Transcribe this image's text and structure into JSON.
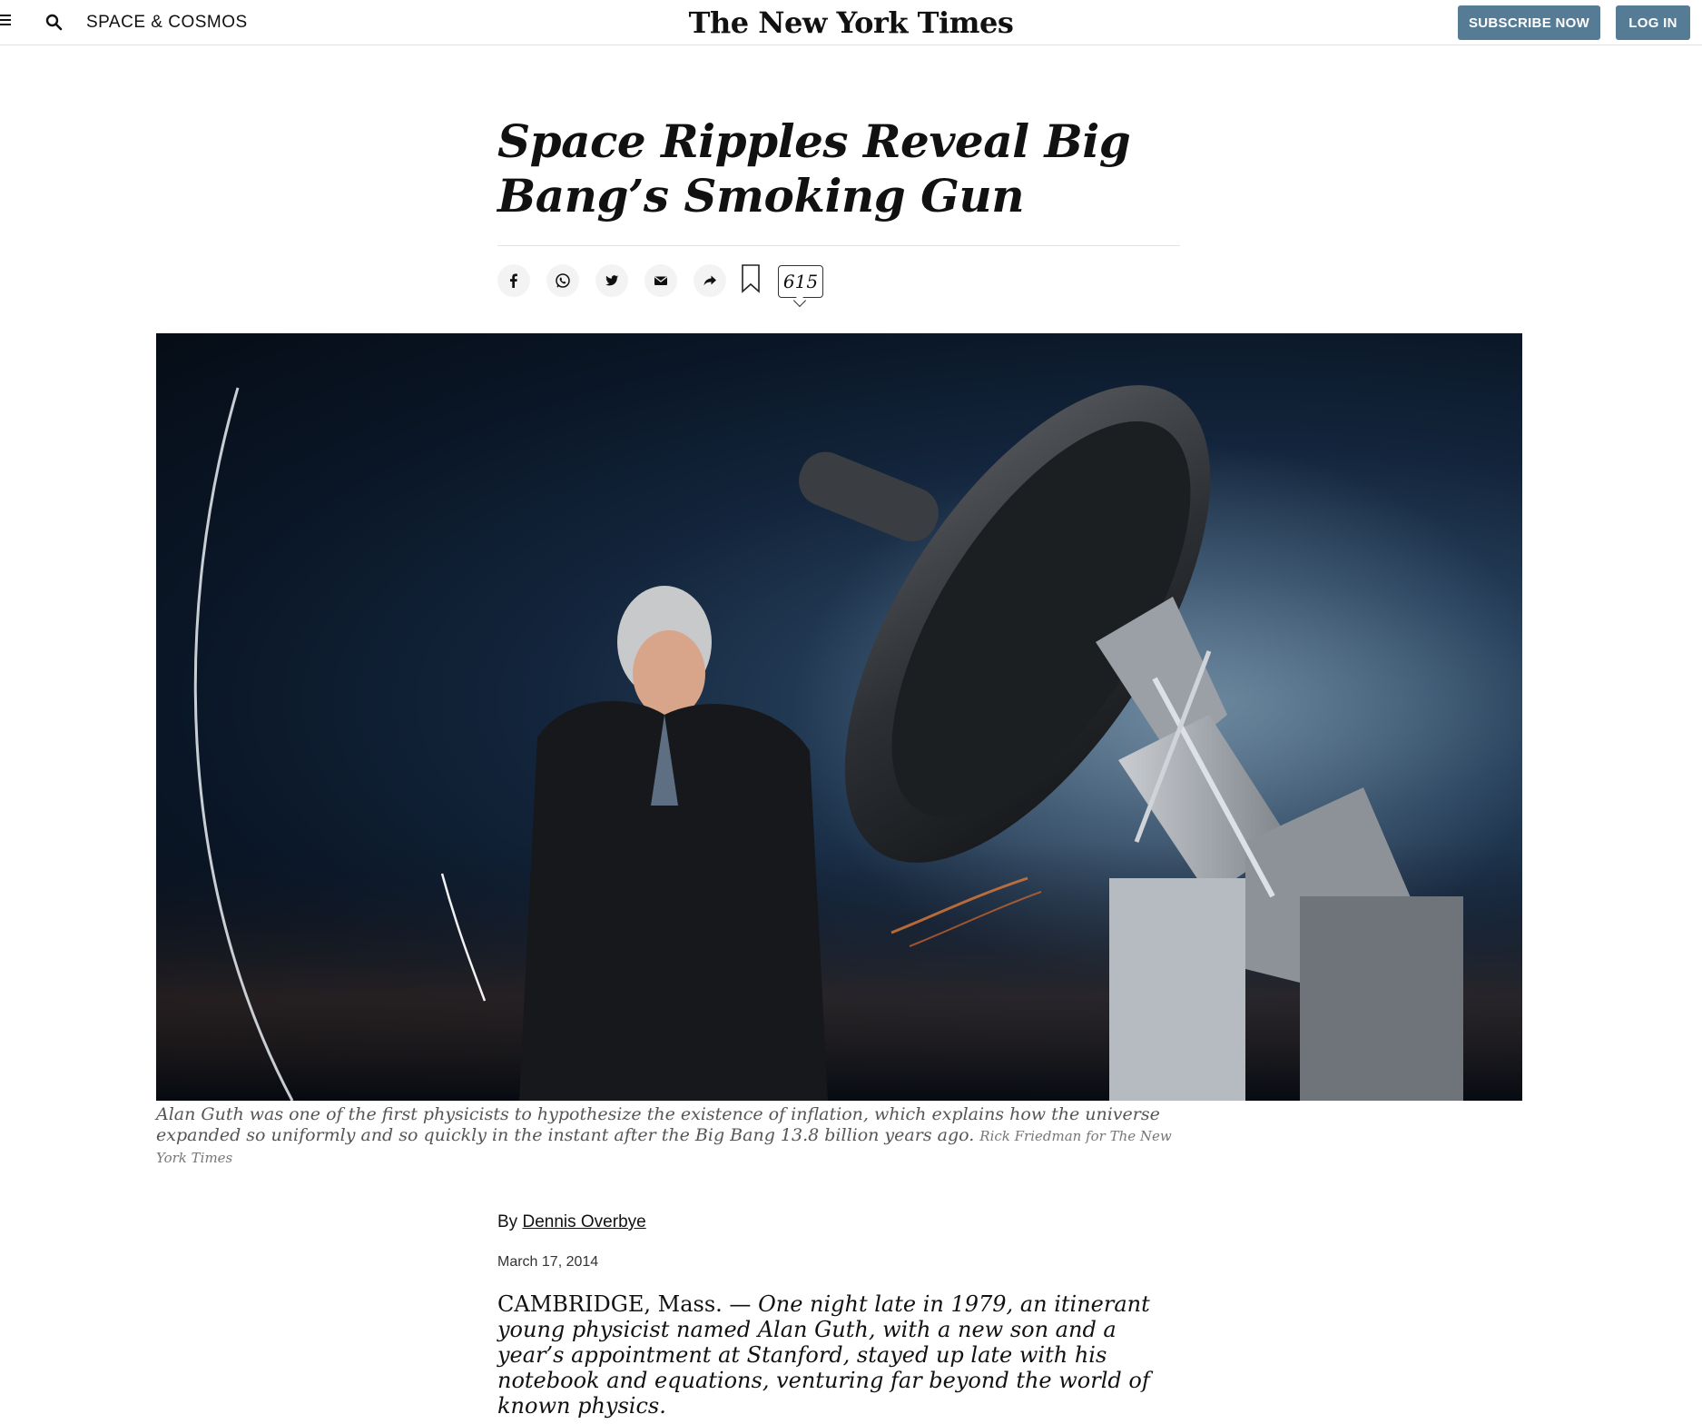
{
  "header": {
    "section": "SPACE & COSMOS",
    "masthead": "The New York Times",
    "subscribe_label": "SUBSCRIBE NOW",
    "login_label": "LOG IN"
  },
  "article": {
    "headline": "Space Ripples Reveal Big Bang’s Smoking Gun",
    "comment_count": "615",
    "caption": "Alan Guth was one of the first physicists to hypothesize the existence of inflation, which explains how the universe expanded so uniformly and so quickly in the instant after the Big Bang 13.8 billion years ago.",
    "photo_credit": "Rick Friedman for The New York Times",
    "byline_prefix": "By",
    "author": "Dennis Overbye",
    "date": "March 17, 2014",
    "lede_place": "CAMBRIDGE, Mass. —",
    "lede_text": "One night late in 1979, an itinerant young physicist named Alan Guth, with a new son and a year’s appointment at Stanford, stayed up late with his notebook and equations, venturing far beyond the world of known physics."
  },
  "share": {
    "icons": [
      "facebook-icon",
      "whatsapp-icon",
      "twitter-icon",
      "email-icon",
      "share-icon",
      "bookmark-icon",
      "comment-icon"
    ]
  },
  "colors": {
    "button_bg": "#567b95",
    "text": "#111111",
    "caption": "#555555"
  }
}
